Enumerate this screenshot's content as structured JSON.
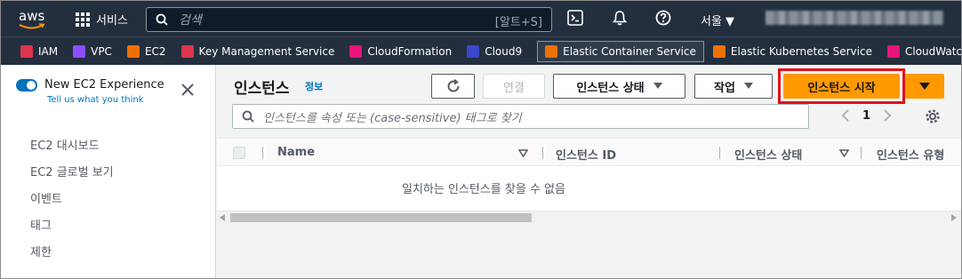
{
  "topnav": {
    "logo": "aws",
    "services_label": "서비스",
    "search_placeholder": "검색",
    "search_shortcut": "[알트+S]",
    "region": "서울 ▼",
    "icons": [
      "cloudshell-icon",
      "bell-icon",
      "help-icon"
    ]
  },
  "favorites": [
    {
      "label": "IAM",
      "color": "#dd344c"
    },
    {
      "label": "VPC",
      "color": "#8c4fff"
    },
    {
      "label": "EC2",
      "color": "#ed7100"
    },
    {
      "label": "Key Management Service",
      "color": "#dd344c"
    },
    {
      "label": "CloudFormation",
      "color": "#e7157b"
    },
    {
      "label": "Cloud9",
      "color": "#3b48cc"
    },
    {
      "label": "Elastic Container Service",
      "color": "#ed7100"
    },
    {
      "label": "Elastic Kubernetes Service",
      "color": "#ed7100"
    },
    {
      "label": "CloudWatch",
      "color": "#e7157b"
    }
  ],
  "sidebar": {
    "experience_title": "New EC2 Experience",
    "experience_link": "Tell us what you think",
    "items": [
      "EC2 대시보드",
      "EC2 글로벌 보기",
      "이벤트",
      "태그",
      "제한"
    ]
  },
  "main": {
    "title": "인스턴스",
    "info": "정보",
    "buttons": {
      "connect": "연결",
      "instance_state": "인스턴스 상태",
      "actions": "작업",
      "launch": "인스턴스 시작"
    },
    "filter_placeholder": "인스턴스를 속성 또는 (case-sensitive) 태그로 찾기",
    "page": "1",
    "columns": [
      "Name",
      "인스턴스 ID",
      "인스턴스 상태",
      "인스턴스 유형"
    ],
    "empty_message": "일치하는 인스턴스를 찾을 수 없음"
  },
  "colors": {
    "nav_bg": "#232f3e",
    "primary": "#ff9900",
    "link": "#0073bb",
    "highlight": "#e0121b"
  }
}
